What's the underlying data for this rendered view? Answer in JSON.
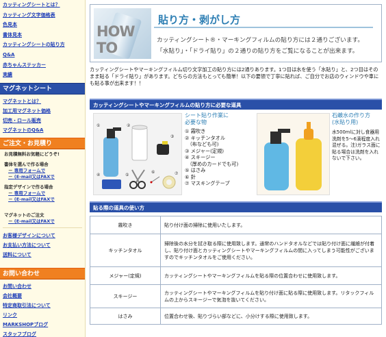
{
  "sidebar": {
    "top_links": [
      "カッティングシートとは？",
      "カッティング文字価格表",
      "色見本",
      "書体見本",
      "カッティングシートの貼り方",
      "Q&A",
      "赤ちゃんステッカー",
      "実績"
    ],
    "magnet_title": "マグネットシート",
    "magnet_links": [
      "マグネットとは？",
      "加工用マグネット価格",
      "切売・ロール販売",
      "マグネットのQ&A"
    ],
    "order_title": "ご注文・お見積り",
    "order_note": "お見積無料お気軽にどうぞ!",
    "order_groups": [
      {
        "label": "書体を選んで作る場合",
        "links": [
          "専用フォームで",
          "(E-mail又はFAXで"
        ]
      },
      {
        "label": "指定デザインで作る場合",
        "links": [
          "専用フォームで",
          "(E-mail又はFAXで"
        ]
      },
      {
        "label": "マグネットのご注文",
        "links": [
          "(E-mail又はFAXで"
        ]
      }
    ],
    "extra_links": [
      "お客様デザインについて",
      "お支払い方法について",
      "送料について"
    ],
    "contact_title": "お問い合わせ",
    "contact_links": [
      "お問い合わせ",
      "会社概要",
      "特定商取引法について",
      "リンク",
      "MARKSHOPブログ",
      "スタッフブログ"
    ]
  },
  "banner": {
    "howto": "HOW TO",
    "title": "貼り方・剥がし方",
    "desc_line1": "カッティングシート®・マーキングフィルムの貼り方には２通りございます。",
    "desc_line2": "「水貼り」・「ドライ貼り」の２通りの貼り方をご覧になることが出来ます。"
  },
  "intro": "カッティングシートやマーキングフィルム切り文字加工の貼り方には2通りあります。1つ目は水を使う「水貼り」と、2つ目はそのまま貼る「ドライ貼り」があります。どちらの方法もとっても簡単！以下の要領で丁寧に貼れば、ご自分でお店のウィンドウや車にも貼る事が出来ます！！",
  "tools_section": {
    "bar": "カッティングシートやマーキングフィルムの貼り方に必要な道具",
    "caption_line1": "シート貼り作業に",
    "caption_line2": "必要な物",
    "items": [
      "① 霧吹き",
      "② キッチンタオル",
      "　（布なども可)",
      "③ メジャー(定規)",
      "④ スキージー",
      "　（厚めのカードでも可)",
      "⑤ はさみ",
      "⑥ 針",
      "⑦ マスキングテープ"
    ],
    "photo_numbers": [
      "①",
      "②",
      "③",
      "④",
      "⑤",
      "⑥",
      "⑦"
    ],
    "water_title_line1": "石鹸水の作り方",
    "water_title_line2": "(水貼り用)",
    "water_desc": "水500mlに対し食器用洗剤を5～6滴程度入れ混ぜる。注)ガラス面に貼る場合は洗剤を入れ　ないで下さい。"
  },
  "usage_section": {
    "bar": "貼る際の道具の使い方",
    "rows": [
      {
        "name": "霧吹き",
        "desc": "貼り付け面の掃除に使用いたします。"
      },
      {
        "name": "キッチンタオル",
        "desc": "掃除後の水分を拭き取る際に使用致します。通常のハンドタオルなどでは貼り付け面に繊維が付着し、貼り付け面とカッティングシートやマーキングフィルムの間に入ってしまう可能性がございますのでキッチンタオルをご使用ください。"
      },
      {
        "name": "メジャー(定規)",
        "desc": "カッティングシートやマーキングフィルムを貼る際の位置合わせに使用致します。"
      },
      {
        "name": "スキージー",
        "desc": "カッティングシートやマーキングフィルムを貼り付け面に貼る際に使用致します。リタックフィルムの上からスキージーで気泡を抜いてください。"
      },
      {
        "name": "はさみ",
        "desc": "位置合わせ後、貼りづらい部などに、小分けする際に使用致します。"
      }
    ]
  },
  "colors": {
    "section_bar": "#2a50a8",
    "accent_orange": "#f08020",
    "link_blue": "#1f3fb8",
    "title_blue": "#2e7fb4"
  }
}
